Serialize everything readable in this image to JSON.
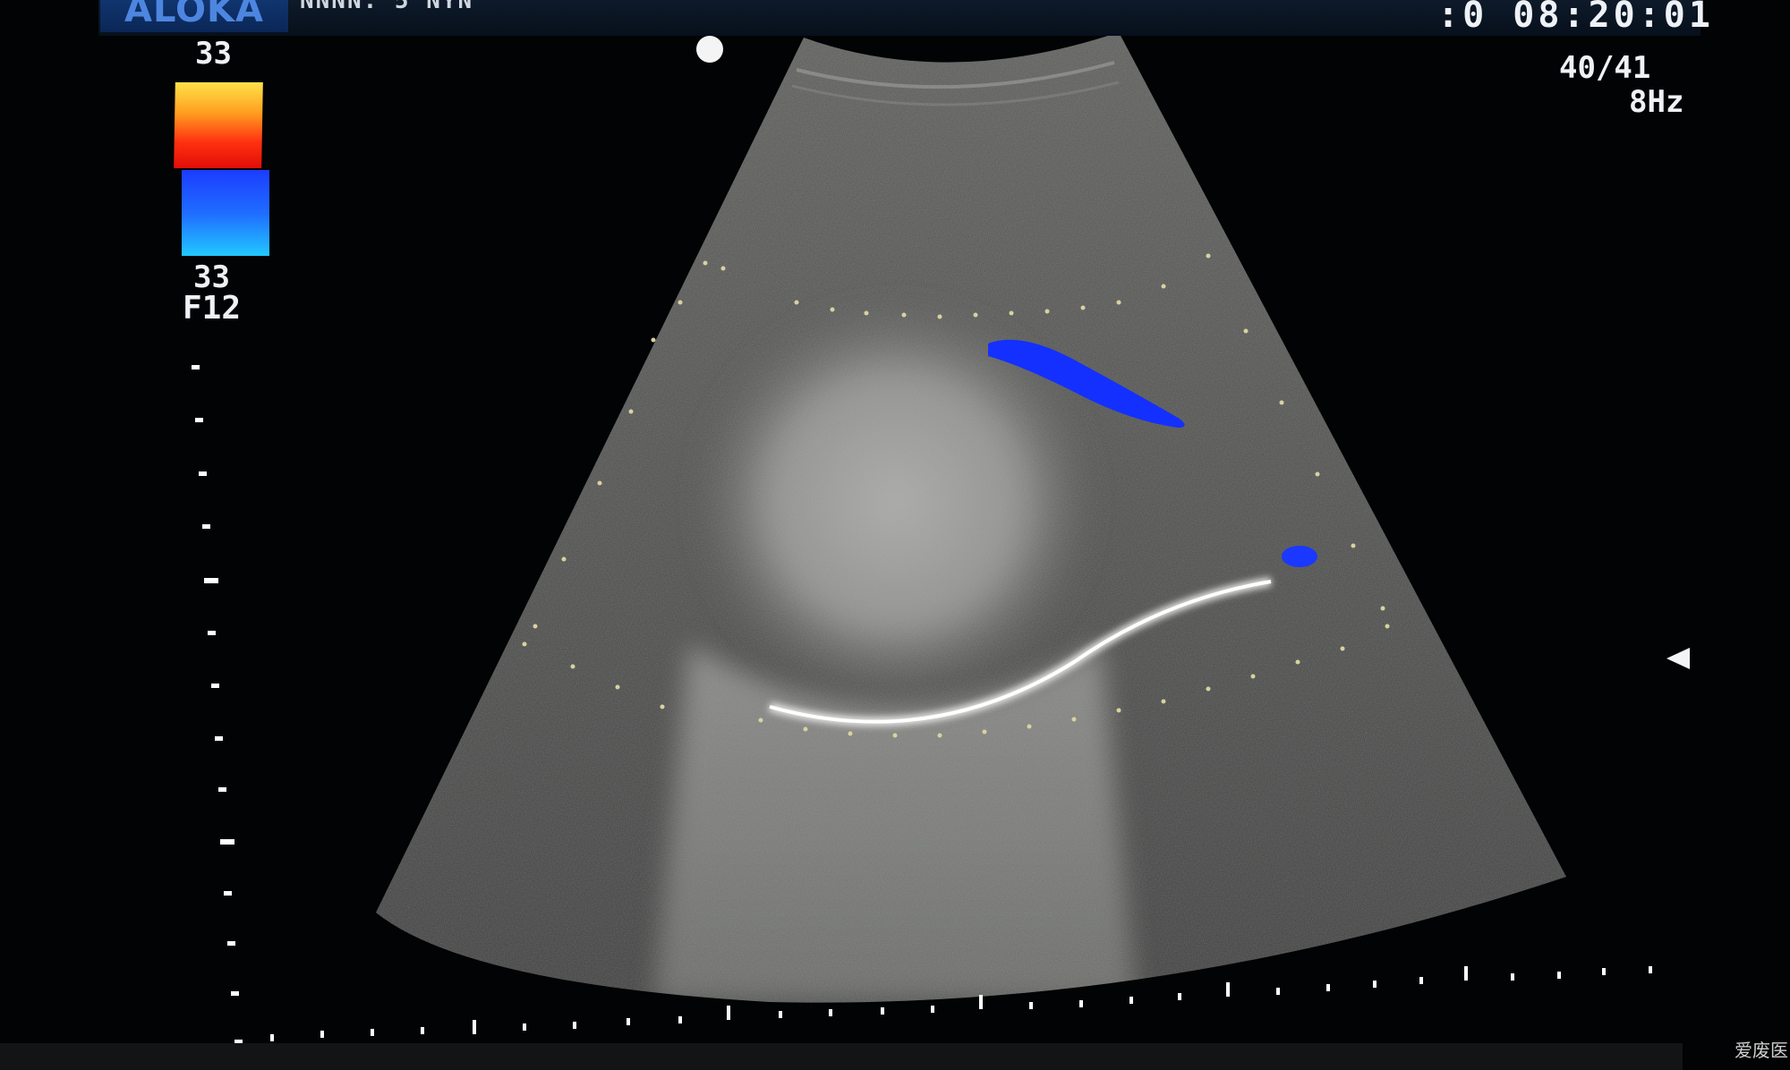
{
  "header": {
    "brand": "ALOKA",
    "patient_info": "NNNN. 5  NYN",
    "clock": ":0 08:20:01"
  },
  "color_scale": {
    "top_value": "33",
    "bottom_value": "33",
    "frequency_label": "F12",
    "warm_colors": [
      "#ffe24a",
      "#ff3010"
    ],
    "cool_colors": [
      "#1c3cff",
      "#22c8ff"
    ]
  },
  "status": {
    "frame_readout": "40/41",
    "frame_rate": "8Hz"
  },
  "watermark": "爱废医",
  "colors": {
    "background": "#020304",
    "doppler_flow": "#1430ff",
    "text": "#eef2f6"
  },
  "icons": [
    "focus-marker-icon",
    "orientation-dot-icon"
  ]
}
